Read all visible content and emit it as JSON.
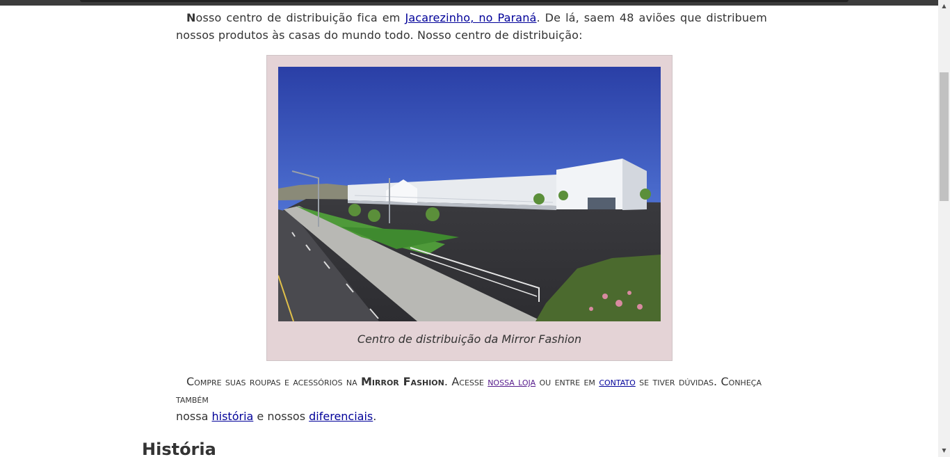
{
  "intro": {
    "dropcap": "N",
    "text_before_link": "osso centro de distribuição fica em ",
    "location_link": "Jacarezinho, no Paraná",
    "text_after_link": ". De lá, saem 48 aviões que distribuem nossos produtos às casas do mundo todo. Nosso centro de distribuição:"
  },
  "figure": {
    "caption": "Centro de distribuição da Mirror Fashion",
    "image_alt": "Centro de distribuição da Mirror Fashion"
  },
  "cta": {
    "text1": "Compre suas roupas e acessórios na ",
    "brand": "Mirror Fashion",
    "text2": ". Acesse ",
    "store_link": "nossa loja",
    "text3": " ou entre em ",
    "contact_link": "contato",
    "text4": " se tiver dúvidas. Conheça também",
    "text5": "nossa ",
    "history_link": "história",
    "text6": " e nossos ",
    "differentials_link": "diferenciais",
    "text7": "."
  },
  "section_heading": "História",
  "colors": {
    "figure_bg": "#e4d3d6",
    "link": "#000099",
    "visited_link": "#551a8b",
    "text": "#333333"
  }
}
